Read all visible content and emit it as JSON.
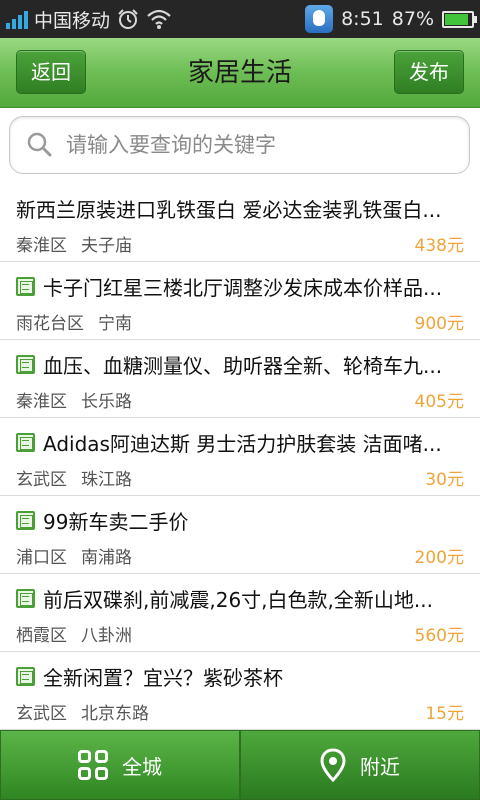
{
  "status_bar": {
    "carrier": "中国移动",
    "time": "8:51",
    "battery": "87%",
    "battery_level": 0.87,
    "icons": [
      "signal-icon",
      "alarm-icon",
      "wifi-icon",
      "qq-icon",
      "battery-icon"
    ]
  },
  "header": {
    "title": "家居生活",
    "back_label": "返回",
    "publish_label": "发布"
  },
  "search": {
    "placeholder": "请输入要查询的关键字",
    "value": ""
  },
  "listings": [
    {
      "has_image": false,
      "title": "新西兰原装进口乳铁蛋白 爱必达金装乳铁蛋白...",
      "district": "秦淮区",
      "location": "夫子庙",
      "price": "438元"
    },
    {
      "has_image": true,
      "title": "卡子门红星三楼北厅调整沙发床成本价样品...",
      "district": "雨花台区",
      "location": "宁南",
      "price": "900元"
    },
    {
      "has_image": true,
      "title": "血压、血糖测量仪、助听器全新、轮椅车九...",
      "district": "秦淮区",
      "location": "长乐路",
      "price": "405元"
    },
    {
      "has_image": true,
      "title": "Adidas阿迪达斯 男士活力护肤套装 洁面啫...",
      "district": "玄武区",
      "location": "珠江路",
      "price": "30元"
    },
    {
      "has_image": true,
      "title": "99新车卖二手价",
      "district": "浦口区",
      "location": "南浦路",
      "price": "200元"
    },
    {
      "has_image": true,
      "title": "前后双碟刹,前减震,26寸,白色款,全新山地...",
      "district": "栖霞区",
      "location": "八卦洲",
      "price": "560元"
    },
    {
      "has_image": true,
      "title": "全新闲置？宜兴？紫砂茶杯",
      "district": "玄武区",
      "location": "北京东路",
      "price": "15元"
    }
  ],
  "bottom_tabs": {
    "all_label": "全城",
    "nearby_label": "附近"
  },
  "colors": {
    "accent_green": "#52a93c",
    "price_orange": "#f0a43a",
    "status_bar_bg": "#262626"
  }
}
